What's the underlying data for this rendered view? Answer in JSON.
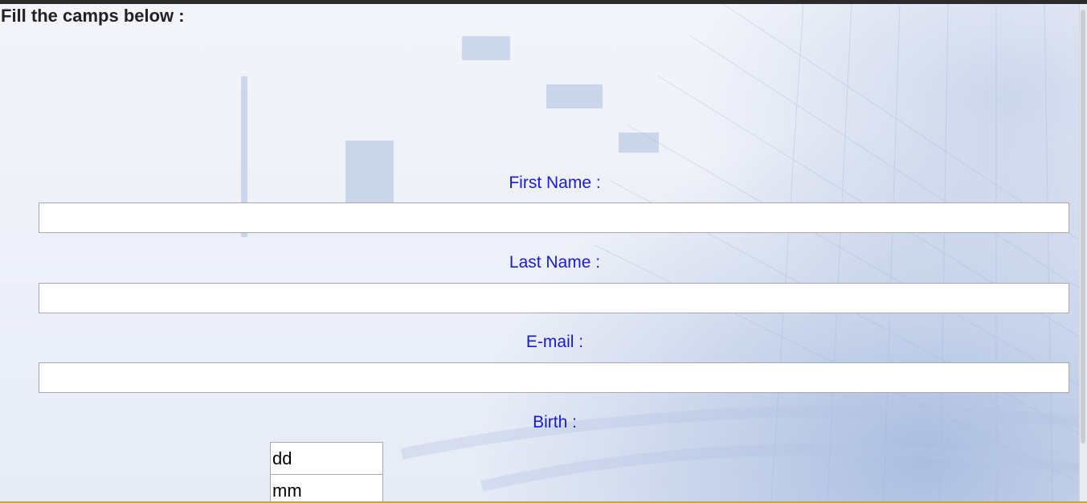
{
  "page": {
    "heading": "Fill the camps below :"
  },
  "form": {
    "first_name_label": "First Name :",
    "first_name_value": "",
    "last_name_label": "Last Name :",
    "last_name_value": "",
    "email_label": "E-mail :",
    "email_value": "",
    "birth_label": "Birth :",
    "birth_day_value": "dd",
    "birth_month_value": "mm"
  },
  "colors": {
    "label_color": "#1a1ad6",
    "heading_color": "#222222",
    "background": "#eef1f8"
  }
}
